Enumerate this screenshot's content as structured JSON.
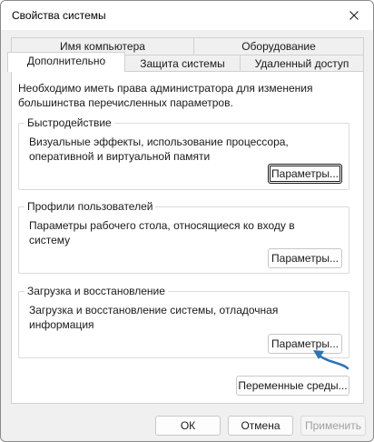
{
  "window": {
    "title": "Свойства системы"
  },
  "tabs": {
    "computer_name": "Имя компьютера",
    "hardware": "Оборудование",
    "advanced": "Дополнительно",
    "protection": "Защита системы",
    "remote": "Удаленный доступ"
  },
  "intro": "Необходимо иметь права администратора для изменения большинства перечисленных параметров.",
  "performance": {
    "legend": "Быстродействие",
    "description": "Визуальные эффекты, использование процессора, оперативной и виртуальной памяти",
    "button": "Параметры..."
  },
  "profiles": {
    "legend": "Профили пользователей",
    "description": "Параметры рабочего стола, относящиеся ко входу в систему",
    "button": "Параметры..."
  },
  "startup": {
    "legend": "Загрузка и восстановление",
    "description": "Загрузка и восстановление системы, отладочная информация",
    "button": "Параметры..."
  },
  "env_button": "Переменные среды...",
  "footer": {
    "ok": "ОК",
    "cancel": "Отмена",
    "apply": "Применить"
  },
  "colors": {
    "arrow": "#2a73b8",
    "focus_border": "#1a1a1a"
  },
  "icons": {
    "close": "close-icon",
    "annotation": "arrow-icon"
  }
}
